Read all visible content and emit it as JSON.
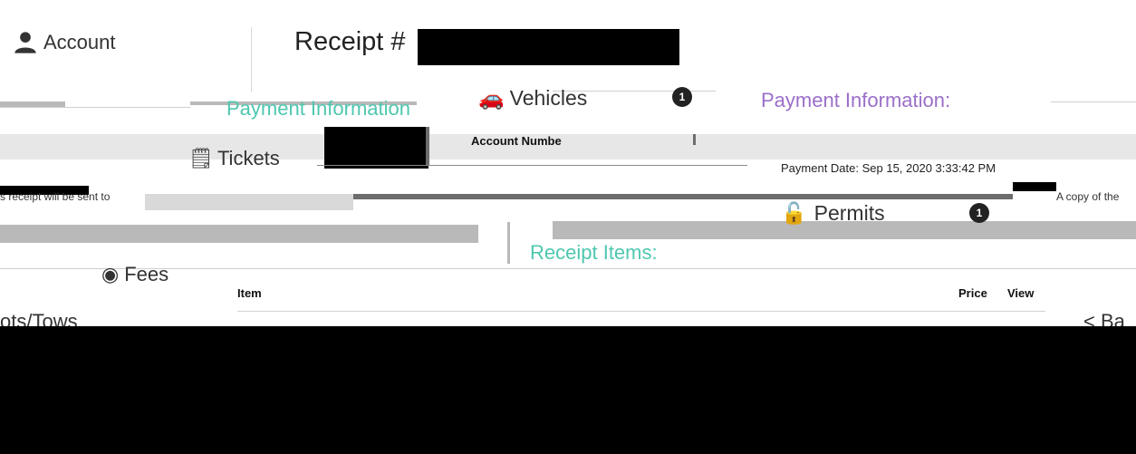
{
  "header": {
    "account_label": "Account",
    "account_icon": "person-icon",
    "receipt_title": "Receipt #"
  },
  "nav": {
    "vehicles_label": "Vehicles",
    "vehicles_count": "1",
    "tickets_label": "Tickets",
    "permits_label": "Permits",
    "permits_count": "1",
    "fees_label": "Fees",
    "lots_tows_label": "ots/Tows",
    "back_label": "< Ba"
  },
  "payment": {
    "heading_left": "Payment Information",
    "heading_right": "Payment Information:",
    "account_number_label": "Account Numbe",
    "payment_date_text": "Payment Date: Sep 15, 2020 3:33:42 PM"
  },
  "notes": {
    "left": "s receipt will be sent to",
    "right": "A copy of the"
  },
  "receipt_items": {
    "heading": "Receipt Items:",
    "columns": [
      "Item",
      "Price",
      "View"
    ]
  },
  "colors": {
    "teal_heading": "#4fc7b0",
    "purple_heading": "#9b6fc9",
    "badge": "#222222",
    "redaction": "#000000"
  }
}
